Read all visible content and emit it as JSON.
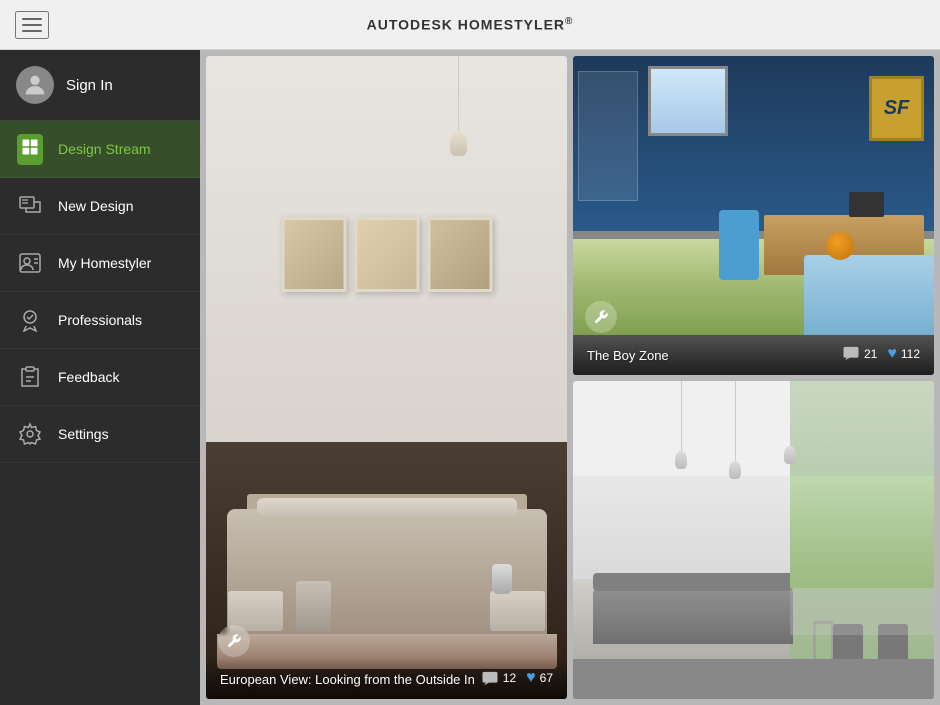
{
  "app": {
    "title": "AUTODESK ",
    "title_bold": "HOMESTYLER",
    "trademark": "®"
  },
  "topbar": {
    "menu_label": "Menu"
  },
  "sidebar": {
    "sign_in_label": "Sign In",
    "items": [
      {
        "id": "design-stream",
        "label": "Design Stream",
        "active": true
      },
      {
        "id": "new-design",
        "label": "New Design",
        "active": false
      },
      {
        "id": "my-homestyler",
        "label": "My Homestyler",
        "active": false
      },
      {
        "id": "professionals",
        "label": "Professionals",
        "active": false
      },
      {
        "id": "feedback",
        "label": "Feedback",
        "active": false
      },
      {
        "id": "settings",
        "label": "Settings",
        "active": false
      }
    ]
  },
  "cards": {
    "main": {
      "title": "European View: Looking from the Outside In",
      "comments": "12",
      "likes": "67"
    },
    "boyzone": {
      "title": "The Boy Zone",
      "comments": "21",
      "likes": "112"
    },
    "modern": {
      "title": "",
      "comments": "",
      "likes": ""
    }
  }
}
